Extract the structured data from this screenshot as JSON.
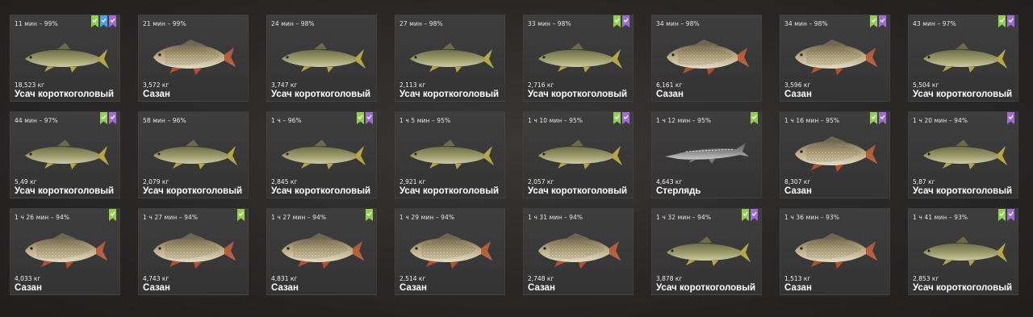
{
  "badge_colors": {
    "green": "#8fd14f",
    "blue": "#4aa3e8",
    "purple": "#a06bd6"
  },
  "fish_species": {
    "barbel": {
      "icon": "barbel-fish-icon",
      "body": "#9a9a6a",
      "belly": "#d8d2b0",
      "back": "#6b6b45",
      "fin": "#b8a640"
    },
    "carp": {
      "icon": "carp-fish-icon",
      "body": "#b8a880",
      "belly": "#e4dcc4",
      "back": "#6e6650",
      "fin": "#b5502e"
    },
    "sterlet": {
      "icon": "sterlet-fish-icon",
      "body": "#8a8a8a",
      "belly": "#c8c8c8",
      "back": "#5d5d5d",
      "fin": "#7a7a7a"
    }
  },
  "cards": [
    {
      "time": "11 мин – 99%",
      "weight": "18,523 кг",
      "name": "Усач короткоголовый",
      "species": "barbel",
      "badges": [
        "green",
        "blue",
        "purple"
      ]
    },
    {
      "time": "21 мин – 99%",
      "weight": "3,572 кг",
      "name": "Сазан",
      "species": "carp",
      "badges": []
    },
    {
      "time": "24 мин – 98%",
      "weight": "3,747 кг",
      "name": "Усач короткоголовый",
      "species": "barbel",
      "badges": []
    },
    {
      "time": "27 мин – 98%",
      "weight": "2,113 кг",
      "name": "Усач короткоголовый",
      "species": "barbel",
      "badges": []
    },
    {
      "time": "33 мин – 98%",
      "weight": "2,716 кг",
      "name": "Усач короткоголовый",
      "species": "barbel",
      "badges": [
        "green",
        "purple"
      ]
    },
    {
      "time": "34 мин – 98%",
      "weight": "6,161 кг",
      "name": "Сазан",
      "species": "carp",
      "badges": []
    },
    {
      "time": "34 мин – 98%",
      "weight": "3,596 кг",
      "name": "Сазан",
      "species": "carp",
      "badges": [
        "green",
        "purple"
      ]
    },
    {
      "time": "43 мин – 97%",
      "weight": "5,504 кг",
      "name": "Усач короткоголовый",
      "species": "barbel",
      "badges": [
        "green",
        "purple"
      ]
    },
    {
      "time": "44 мин – 97%",
      "weight": "5,49 кг",
      "name": "Усач короткоголовый",
      "species": "barbel",
      "badges": [
        "green",
        "purple"
      ]
    },
    {
      "time": "58 мин – 96%",
      "weight": "2,079 кг",
      "name": "Усач короткоголовый",
      "species": "barbel",
      "badges": []
    },
    {
      "time": "1 ч – 96%",
      "weight": "2,845 кг",
      "name": "Усач короткоголовый",
      "species": "barbel",
      "badges": [
        "green",
        "purple"
      ]
    },
    {
      "time": "1 ч 5 мин – 95%",
      "weight": "2,921 кг",
      "name": "Усач короткоголовый",
      "species": "barbel",
      "badges": []
    },
    {
      "time": "1 ч 10 мин – 95%",
      "weight": "2,057 кг",
      "name": "Усач короткоголовый",
      "species": "barbel",
      "badges": [
        "green",
        "purple"
      ]
    },
    {
      "time": "1 ч 12 мин – 95%",
      "weight": "4,643 кг",
      "name": "Стерлядь",
      "species": "sterlet",
      "badges": [
        "green"
      ]
    },
    {
      "time": "1 ч 16 мин – 95%",
      "weight": "8,307 кг",
      "name": "Сазан",
      "species": "carp",
      "badges": [
        "green",
        "purple"
      ]
    },
    {
      "time": "1 ч 20 мин – 94%",
      "weight": "5,87 кг",
      "name": "Усач короткоголовый",
      "species": "barbel",
      "badges": [
        "purple"
      ]
    },
    {
      "time": "1 ч 26 мин – 94%",
      "weight": "4,033 кг",
      "name": "Сазан",
      "species": "carp",
      "badges": [
        "green"
      ]
    },
    {
      "time": "1 ч 27 мин – 94%",
      "weight": "4,743 кг",
      "name": "Сазан",
      "species": "carp",
      "badges": [
        "green"
      ]
    },
    {
      "time": "1 ч 27 мин – 94%",
      "weight": "4,831 кг",
      "name": "Сазан",
      "species": "carp",
      "badges": [
        "green"
      ]
    },
    {
      "time": "1 ч 29 мин – 94%",
      "weight": "2,514 кг",
      "name": "Сазан",
      "species": "carp",
      "badges": []
    },
    {
      "time": "1 ч 31 мин – 94%",
      "weight": "2,748 кг",
      "name": "Сазан",
      "species": "carp",
      "badges": []
    },
    {
      "time": "1 ч 32 мин – 94%",
      "weight": "3,878 кг",
      "name": "Усач короткоголовый",
      "species": "barbel",
      "badges": [
        "green",
        "purple"
      ]
    },
    {
      "time": "1 ч 36 мин – 93%",
      "weight": "1,513 кг",
      "name": "Сазан",
      "species": "carp",
      "badges": []
    },
    {
      "time": "1 ч 41 мин – 93%",
      "weight": "2,853 кг",
      "name": "Усач короткоголовый",
      "species": "barbel",
      "badges": [
        "green",
        "purple"
      ]
    }
  ]
}
